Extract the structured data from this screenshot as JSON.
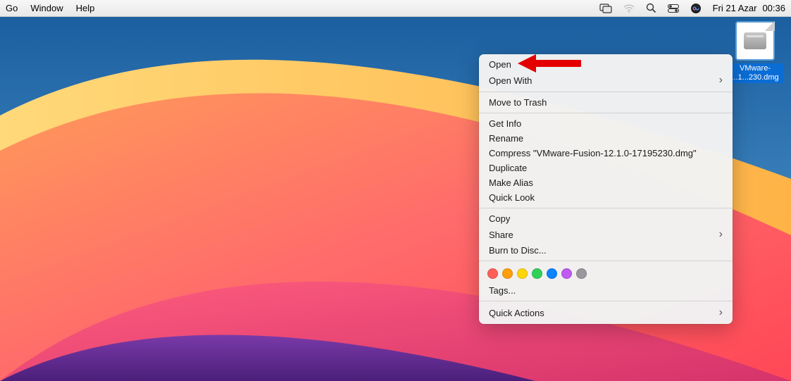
{
  "menubar": {
    "left": [
      {
        "label": "Go"
      },
      {
        "label": "Window"
      },
      {
        "label": "Help"
      }
    ],
    "date_day": "Fri 21 Azar",
    "date_time": "00:36"
  },
  "file": {
    "label_line1": "VMware-",
    "label_line2": "...1...230.dmg"
  },
  "context_menu": {
    "open": "Open",
    "open_with": "Open With",
    "move_to_trash": "Move to Trash",
    "get_info": "Get Info",
    "rename": "Rename",
    "compress": "Compress \"VMware-Fusion-12.1.0-17195230.dmg\"",
    "duplicate": "Duplicate",
    "make_alias": "Make Alias",
    "quick_look": "Quick Look",
    "copy": "Copy",
    "share": "Share",
    "burn": "Burn to Disc...",
    "tags": "Tags...",
    "quick_actions": "Quick Actions"
  },
  "tag_colors": [
    "#ff5f57",
    "#ff9f0a",
    "#ffd60a",
    "#30d158",
    "#0a84ff",
    "#bf5af2",
    "#98989d"
  ]
}
